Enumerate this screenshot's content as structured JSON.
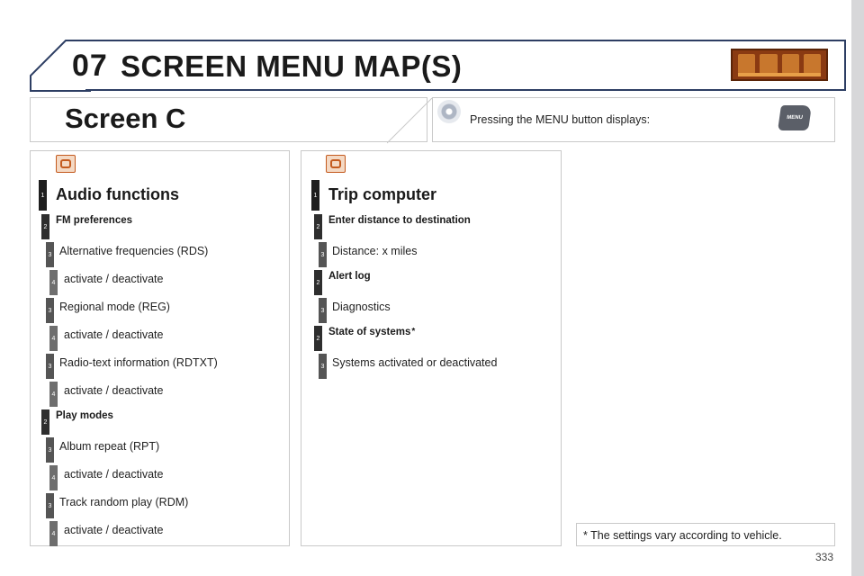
{
  "header": {
    "chapter": "07",
    "title": "SCREEN MENU MAP(S)",
    "thumbnail_icon": "audio-telematics-thumbnail-icon"
  },
  "screen": {
    "title": "Screen C",
    "info_icon": "gear-icon",
    "info_text": "Pressing the MENU button displays:",
    "menu_button_label": "MENU"
  },
  "left_column": {
    "icon": "audio-functions-icon",
    "items": [
      {
        "level": "1",
        "text": "Audio functions"
      },
      {
        "level": "2",
        "text": "FM preferences"
      },
      {
        "level": "3",
        "text": "Alternative frequencies (RDS)"
      },
      {
        "level": "4",
        "text": "activate / deactivate"
      },
      {
        "level": "3",
        "text": "Regional mode (REG)"
      },
      {
        "level": "4",
        "text": "activate / deactivate"
      },
      {
        "level": "3",
        "text": "Radio-text information (RDTXT)"
      },
      {
        "level": "4",
        "text": "activate / deactivate"
      },
      {
        "level": "2",
        "text": "Play modes"
      },
      {
        "level": "3",
        "text": "Album repeat (RPT)"
      },
      {
        "level": "4",
        "text": "activate / deactivate"
      },
      {
        "level": "3",
        "text": "Track random play (RDM)"
      },
      {
        "level": "4",
        "text": "activate / deactivate"
      }
    ]
  },
  "mid_column": {
    "icon": "trip-computer-icon",
    "items": [
      {
        "level": "1",
        "text": "Trip computer"
      },
      {
        "level": "2",
        "text": "Enter distance to destination"
      },
      {
        "level": "3",
        "text": "Distance: x miles"
      },
      {
        "level": "2",
        "text": "Alert log"
      },
      {
        "level": "3",
        "text": "Diagnostics"
      },
      {
        "level": "2",
        "text": "State of systems",
        "star": "*"
      },
      {
        "level": "3",
        "text": "Systems activated or deactivated"
      }
    ]
  },
  "footnote": "* The settings vary according to vehicle.",
  "page_number": "333"
}
